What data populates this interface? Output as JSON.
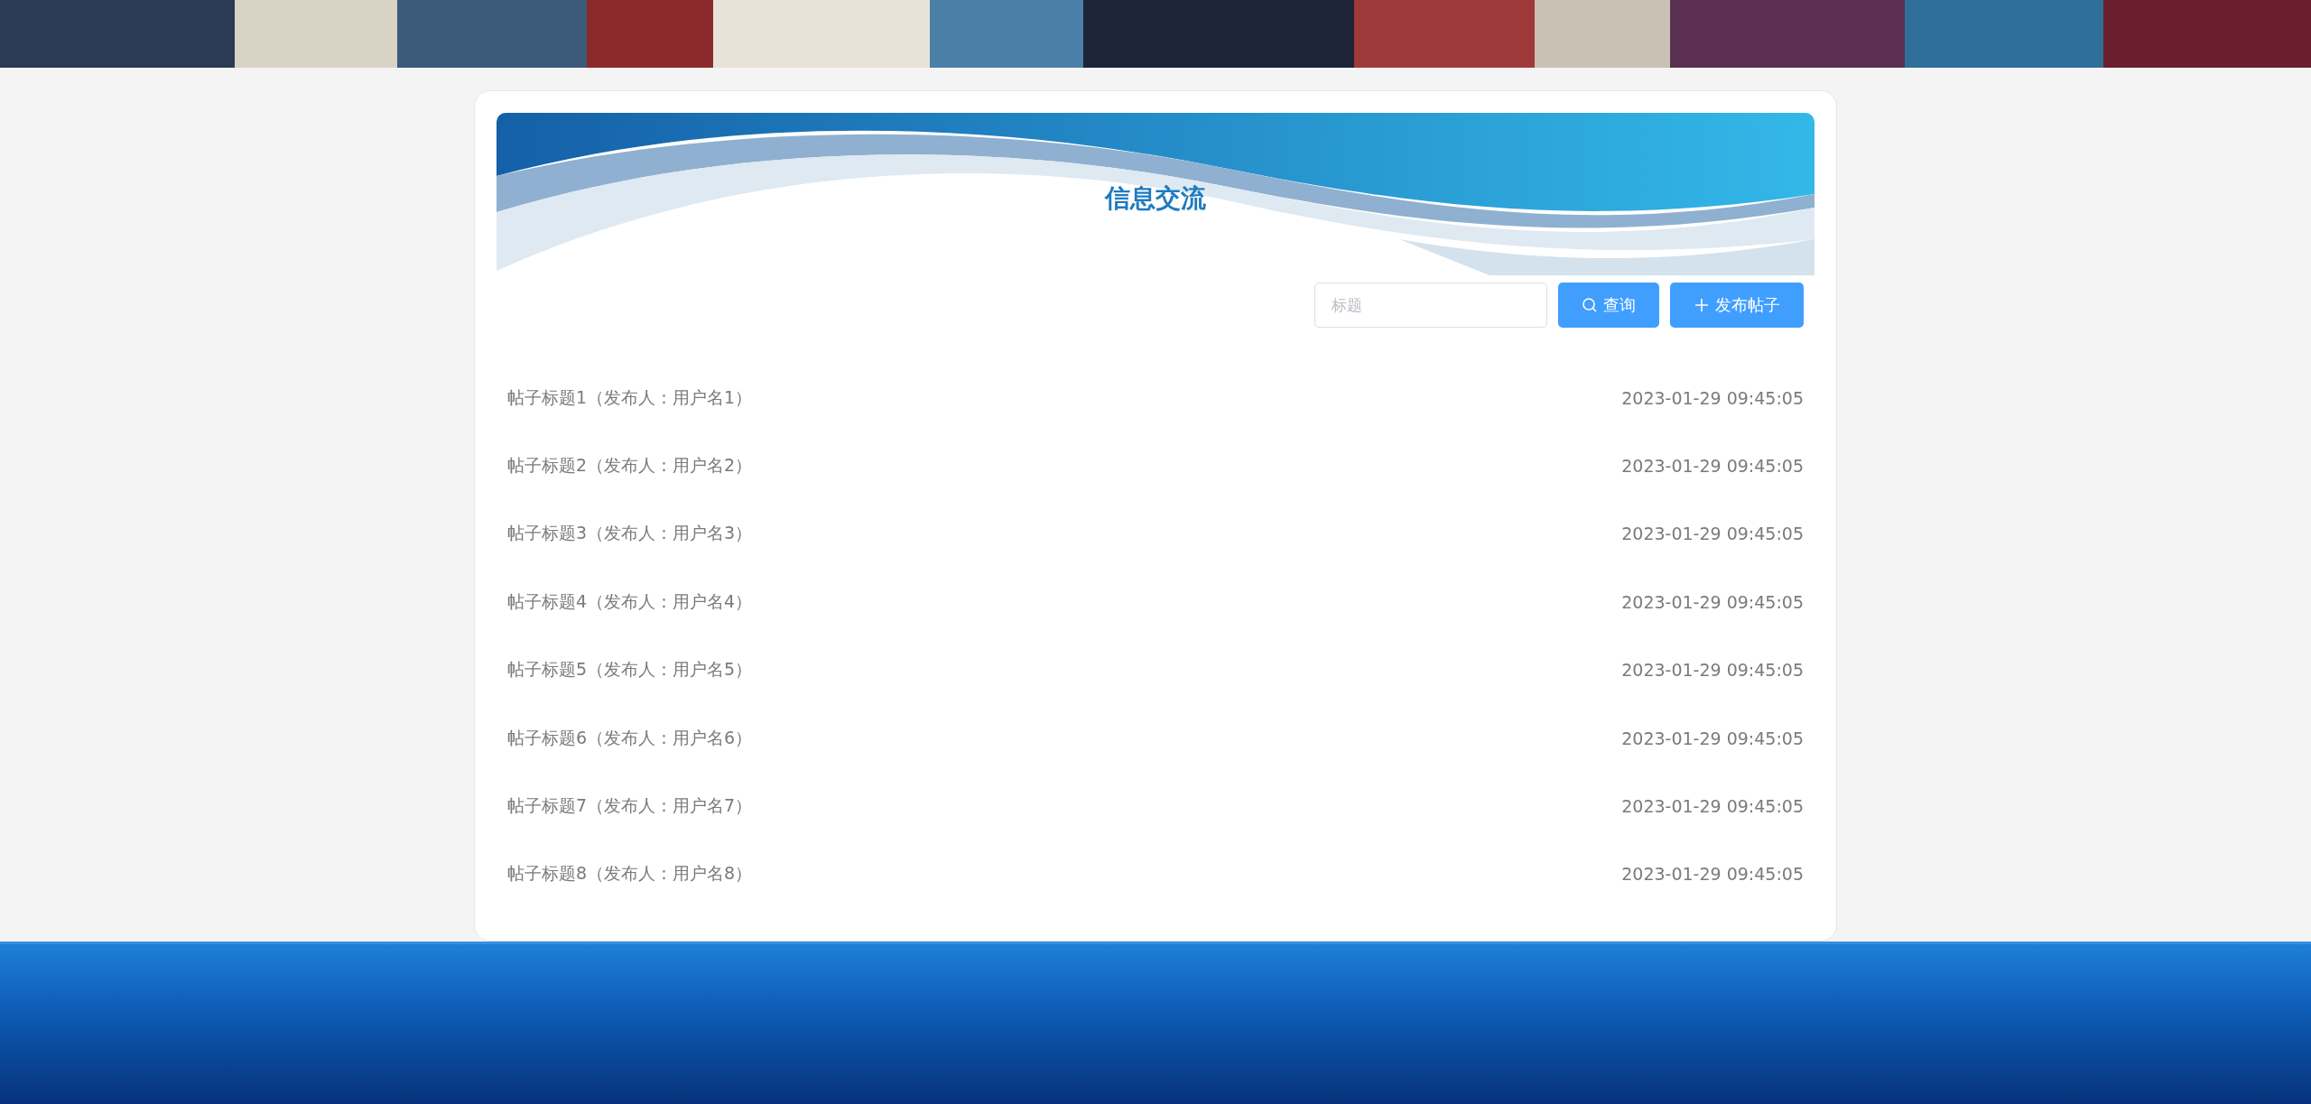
{
  "page_title": "信息交流",
  "search": {
    "placeholder": "标题"
  },
  "buttons": [
    {
      "kind": "search",
      "label": "查询"
    },
    {
      "kind": "add",
      "label": "发布帖子"
    }
  ],
  "posts": [
    {
      "title": "帖子标题1（发布人：用户名1）",
      "time": "2023-01-29 09:45:05"
    },
    {
      "title": "帖子标题2（发布人：用户名2）",
      "time": "2023-01-29 09:45:05"
    },
    {
      "title": "帖子标题3（发布人：用户名3）",
      "time": "2023-01-29 09:45:05"
    },
    {
      "title": "帖子标题4（发布人：用户名4）",
      "time": "2023-01-29 09:45:05"
    },
    {
      "title": "帖子标题5（发布人：用户名5）",
      "time": "2023-01-29 09:45:05"
    },
    {
      "title": "帖子标题6（发布人：用户名6）",
      "time": "2023-01-29 09:45:05"
    },
    {
      "title": "帖子标题7（发布人：用户名7）",
      "time": "2023-01-29 09:45:05"
    },
    {
      "title": "帖子标题8（发布人：用户名8）",
      "time": "2023-01-29 09:45:05"
    }
  ]
}
